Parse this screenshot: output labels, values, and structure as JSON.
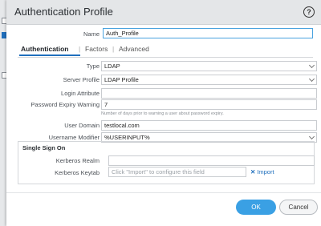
{
  "dialog": {
    "title": "Authentication Profile",
    "help_icon": "question-circle-icon"
  },
  "name": {
    "label": "Name",
    "value": "Auth_Profile"
  },
  "tabs": [
    {
      "label": "Authentication",
      "active": true
    },
    {
      "label": "Factors",
      "active": false
    },
    {
      "label": "Advanced",
      "active": false
    }
  ],
  "form": {
    "type": {
      "label": "Type",
      "value": "LDAP"
    },
    "server_profile": {
      "label": "Server Profile",
      "value": "LDAP Profile"
    },
    "login_attribute": {
      "label": "Login Attribute",
      "value": ""
    },
    "password_expiry": {
      "label": "Password Expiry Warning",
      "value": "7",
      "hint": "Number of days prior to warning a user about password expiry."
    },
    "user_domain": {
      "label": "User Domain",
      "value": "testlocal.com"
    },
    "username_modifier": {
      "label": "Username Modifier",
      "value": "%USERINPUT%"
    }
  },
  "sso": {
    "title": "Single Sign On",
    "kerberos_realm": {
      "label": "Kerberos Realm",
      "value": ""
    },
    "kerberos_keytab": {
      "label": "Kerberos Keytab",
      "placeholder": "Click \"Import\" to configure this field",
      "import_label": "Import"
    }
  },
  "buttons": {
    "ok": "OK",
    "cancel": "Cancel"
  },
  "colors": {
    "accent": "#1f6fbd",
    "ok_button": "#3aa0e4",
    "focus_border": "#4aa3df"
  }
}
